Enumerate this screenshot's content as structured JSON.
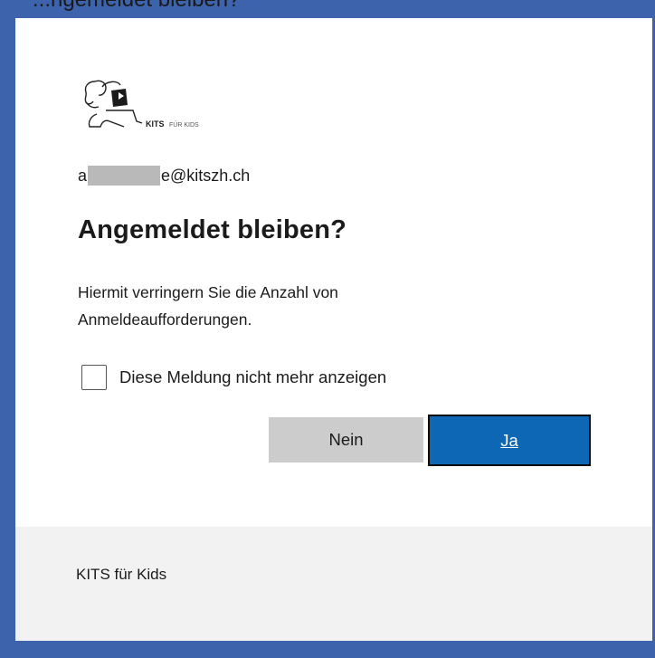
{
  "window": {
    "clipped_title": "...ngemeldet bleiben?"
  },
  "card": {
    "logo": {
      "icon": "kits-fuer-kids-logo",
      "text_bold": "KITS",
      "text_light": "FÜR KIDS"
    },
    "email": {
      "prefix": "a",
      "suffix": "e@kitszh.ch"
    },
    "title": "Angemeldet bleiben?",
    "description": "Hiermit verringern Sie die Anzahl von Anmeldeaufforderungen.",
    "checkbox": {
      "label": "Diese Meldung nicht mehr anzeigen",
      "checked": false
    },
    "buttons": {
      "no": "Nein",
      "yes": "Ja"
    }
  },
  "footer": {
    "text": "KITS für Kids"
  },
  "colors": {
    "frame": "#3e63ad",
    "primary": "#0d67b4",
    "secondary_button": "#cccccc",
    "footer_bg": "#f2f2f2"
  }
}
